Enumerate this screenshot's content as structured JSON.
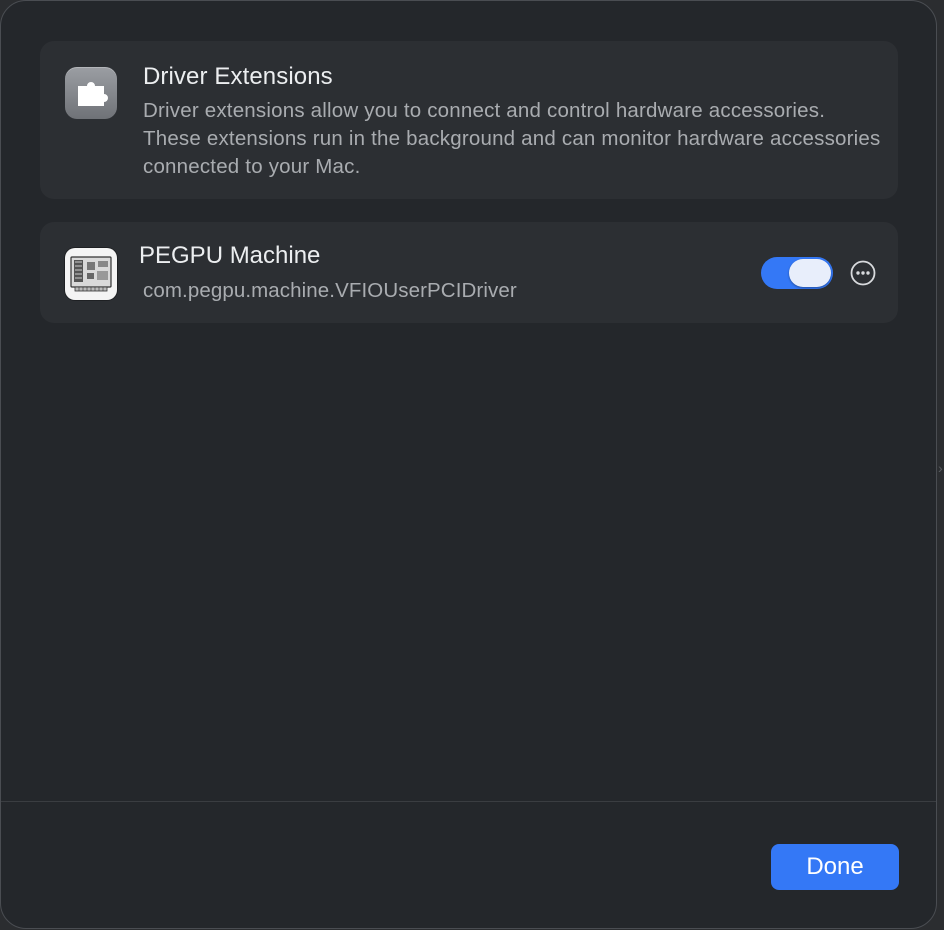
{
  "info": {
    "title": "Driver Extensions",
    "description": "Driver extensions allow you to connect and control hardware accessories. These extensions run in the background and can monitor hardware accessories connected to your Mac.",
    "icon": "puzzle-piece-icon"
  },
  "extensions": [
    {
      "name": "PEGPU Machine",
      "bundle_id": "com.pegpu.machine.VFIOUserPCIDriver",
      "enabled": true,
      "icon": "pci-card-icon"
    }
  ],
  "footer": {
    "done_label": "Done"
  },
  "colors": {
    "accent": "#3478f6",
    "sheet_bg": "#24272b",
    "card_bg": "#2c2f33"
  }
}
